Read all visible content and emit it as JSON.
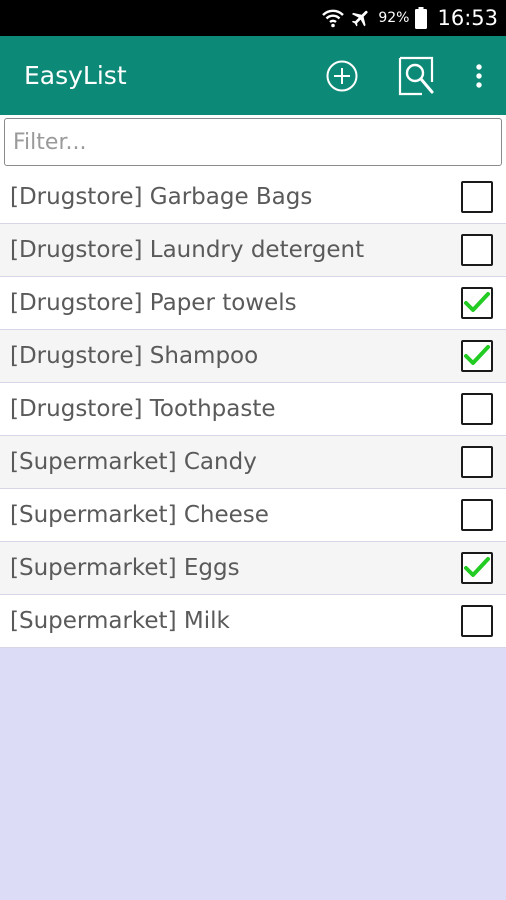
{
  "status_bar": {
    "battery": "92%",
    "time": "16:53",
    "icons": [
      "wifi-icon",
      "airplane-icon",
      "battery-icon"
    ]
  },
  "app_bar": {
    "title": "EasyList",
    "actions": [
      "add-circle-icon",
      "search-icon",
      "overflow-menu-icon"
    ],
    "color": "#0d8a77"
  },
  "filter": {
    "placeholder": "Filter...",
    "value": ""
  },
  "items": [
    {
      "label": "[Drugstore] Garbage Bags",
      "checked": false
    },
    {
      "label": "[Drugstore] Laundry detergent",
      "checked": false
    },
    {
      "label": "[Drugstore] Paper towels",
      "checked": true
    },
    {
      "label": "[Drugstore] Shampoo",
      "checked": true
    },
    {
      "label": "[Drugstore] Toothpaste",
      "checked": false
    },
    {
      "label": "[Supermarket] Candy",
      "checked": false
    },
    {
      "label": "[Supermarket] Cheese",
      "checked": false
    },
    {
      "label": "[Supermarket] Eggs",
      "checked": true
    },
    {
      "label": "[Supermarket] Milk",
      "checked": false
    }
  ],
  "colors": {
    "check": "#22cc22",
    "background": "#dcdcf6"
  }
}
